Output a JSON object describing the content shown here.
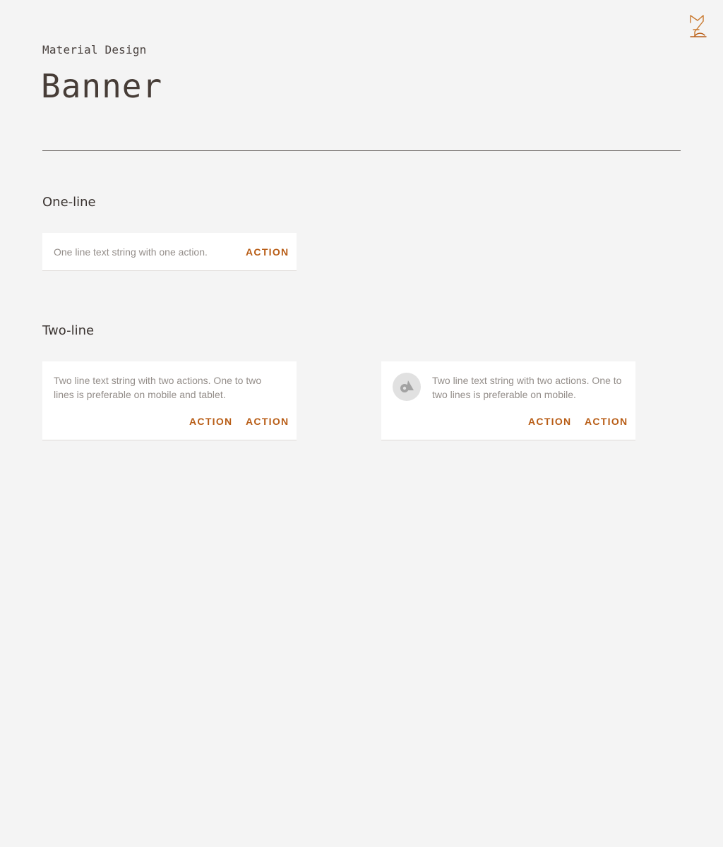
{
  "header": {
    "eyebrow": "Material Design",
    "title": "Banner"
  },
  "sections": {
    "one_line": {
      "heading": "One-line",
      "banner": {
        "text": "One line text string with one action.",
        "action": "ACTION"
      }
    },
    "two_line": {
      "heading": "Two-line",
      "banner_plain": {
        "text": "Two line text string with two actions. One to two lines is preferable on mobile and tablet.",
        "action_1": "ACTION",
        "action_2": "ACTION"
      },
      "banner_with_icon": {
        "icon": "image-placeholder-icon",
        "text": "Two line text string with two actions. One to two lines is preferable on mobile.",
        "action_1": "ACTION",
        "action_2": "ACTION"
      }
    }
  },
  "colors": {
    "background": "#f4f4f4",
    "surface": "#ffffff",
    "accent": "#b85d16",
    "logo": "#c9782d",
    "body_text": "#948e8a",
    "heading_text": "#3b3431"
  }
}
